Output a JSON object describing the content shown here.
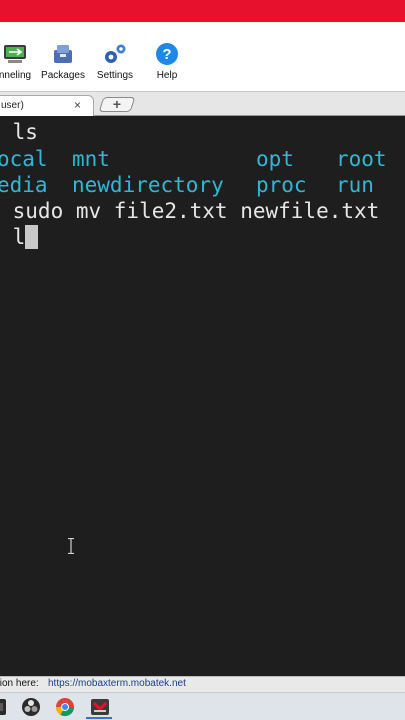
{
  "toolbar": {
    "items": [
      {
        "label": "nneling",
        "icon": "tunneling-icon"
      },
      {
        "label": "Packages",
        "icon": "packages-icon"
      },
      {
        "label": "Settings",
        "icon": "settings-icon"
      },
      {
        "label": "Help",
        "icon": "help-icon"
      }
    ]
  },
  "tabs": {
    "active_label": "user)",
    "close_glyph": "×",
    "new_tab_glyph": "+"
  },
  "terminal": {
    "line1": " ls",
    "dir_local": "ocal",
    "dir_mnt": "mnt",
    "dir_opt": "opt",
    "dir_root": "root",
    "dir_media": "edia",
    "dir_newdirectory": "newdirectory",
    "dir_proc": "proc",
    "dir_run": "run",
    "line4": " sudo mv file2.txt newfile.txt",
    "line5_input": " l"
  },
  "status": {
    "label": "tion here:",
    "link": "https://mobaxterm.mobatek.net"
  },
  "colors": {
    "titlebar": "#e8112d",
    "terminal_bg": "#1e1e1e",
    "terminal_text": "#e6e6e6",
    "directory": "#2fb8d6"
  },
  "taskbar": {
    "items": [
      "app-icon",
      "obs-icon",
      "chrome-icon",
      "mobaxterm-icon"
    ]
  }
}
